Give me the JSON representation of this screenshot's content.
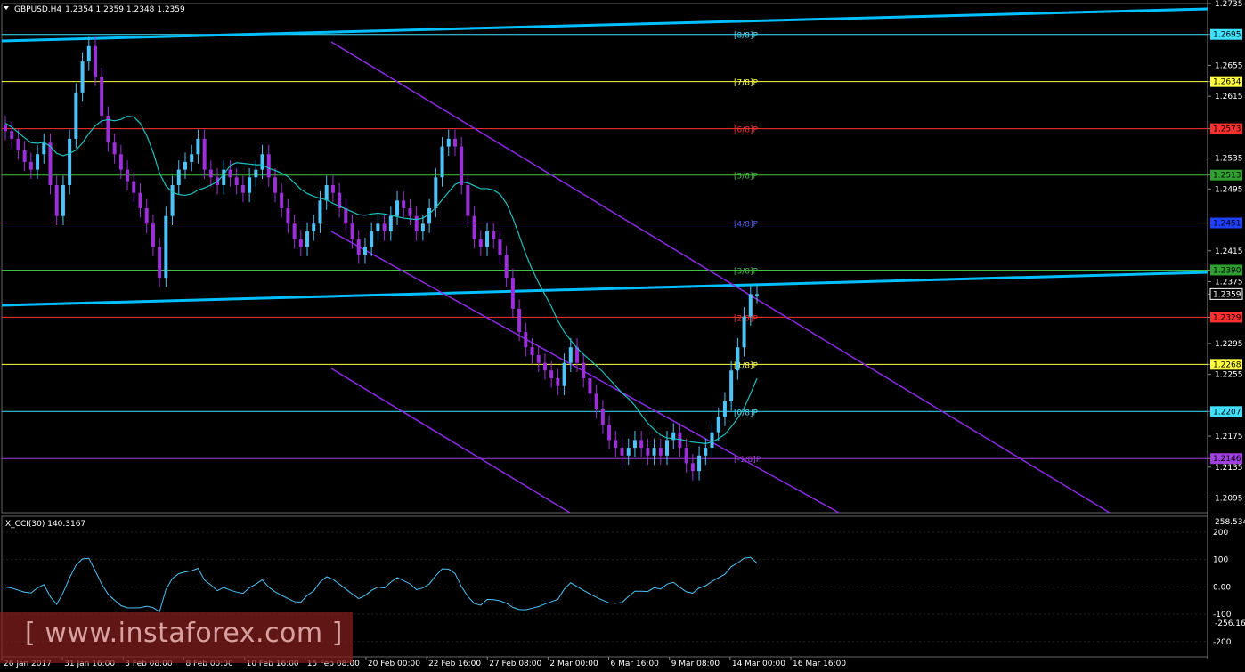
{
  "header": {
    "symbol": "GBPUSD,H4",
    "ohlc": "1.2354 1.2359 1.2348 1.2359"
  },
  "indicator": {
    "label": "X_CCI(30) 140.3167",
    "scale_top": "258.534",
    "scale_bottom": "-256.162",
    "ticks": [
      "200",
      "100",
      "0.00",
      "-100",
      "-200"
    ]
  },
  "watermark": "[ www.instaforex.com ]",
  "colors": {
    "background": "#000000",
    "bull_candle": "#4fc3f7",
    "bear_candle": "#9b30d9",
    "ma_line": "#20c0c0",
    "channel": "#00bfff",
    "trend": "#8a2be2",
    "grid": "#333333"
  },
  "chart_data": {
    "type": "candlestick",
    "symbol": "GBPUSD",
    "timeframe": "H4",
    "price_axis": {
      "range": [
        1.2076,
        1.2735
      ],
      "tick_labels": [
        "1.2735",
        "1.2695",
        "1.2655",
        "1.2634",
        "1.2615",
        "1.2573",
        "1.2535",
        "1.2513",
        "1.2495",
        "1.2451",
        "1.2415",
        "1.2390",
        "1.2375",
        "1.2359",
        "1.2329",
        "1.2295",
        "1.2268",
        "1.2255",
        "1.2207",
        "1.2175",
        "1.2146",
        "1.2135",
        "1.2095"
      ]
    },
    "time_axis": {
      "labels": [
        "26 Jan 2017",
        "31 Jan 16:00",
        "3 Feb 08:00",
        "8 Feb 00:00",
        "10 Feb 16:00",
        "15 Feb 08:00",
        "20 Feb 00:00",
        "22 Feb 16:00",
        "27 Feb 08:00",
        "2 Mar 00:00",
        "6 Mar 16:00",
        "9 Mar 08:00",
        "14 Mar 00:00",
        "16 Mar 16:00"
      ]
    },
    "current_price": 1.2359,
    "murrey_levels": [
      {
        "label": "[8/8]P",
        "price": 1.2695,
        "color": "#40e0ff"
      },
      {
        "label": "[7/8]P",
        "price": 1.2634,
        "color": "#ffff40"
      },
      {
        "label": "[6/8]P",
        "price": 1.2573,
        "color": "#ff3030"
      },
      {
        "label": "[5/8]P",
        "price": 1.2513,
        "color": "#40c040"
      },
      {
        "label": "[4/8]P",
        "price": 1.2451,
        "color": "#4060ff"
      },
      {
        "label": "[3/8]P",
        "price": 1.239,
        "color": "#40c040"
      },
      {
        "label": "[2/8]P",
        "price": 1.2329,
        "color": "#ff3030"
      },
      {
        "label": "[1/8]P",
        "price": 1.2268,
        "color": "#ffff40"
      },
      {
        "label": "[0/8]P",
        "price": 1.2207,
        "color": "#40e0ff"
      },
      {
        "label": "[-1/8]P",
        "price": 1.2146,
        "color": "#a040e0"
      }
    ],
    "price_tags": [
      {
        "text": "1.2695",
        "price": 1.2695,
        "bg": "#40e0ff",
        "fg": "#000000"
      },
      {
        "text": "1.2634",
        "price": 1.2634,
        "bg": "#ffff40",
        "fg": "#000000"
      },
      {
        "text": "1.2573",
        "price": 1.2573,
        "bg": "#ff3030",
        "fg": "#000000"
      },
      {
        "text": "1.2513",
        "price": 1.2513,
        "bg": "#30a030",
        "fg": "#000000"
      },
      {
        "text": "1.2451",
        "price": 1.2451,
        "bg": "#2040ff",
        "fg": "#000000"
      },
      {
        "text": "1.2390",
        "price": 1.239,
        "bg": "#30a030",
        "fg": "#000000"
      },
      {
        "text": "1.2359",
        "price": 1.2359,
        "bg": "#000000",
        "fg": "#ffffff"
      },
      {
        "text": "1.2329",
        "price": 1.2329,
        "bg": "#ff3030",
        "fg": "#000000"
      },
      {
        "text": "1.2268",
        "price": 1.2268,
        "bg": "#ffff40",
        "fg": "#000000"
      },
      {
        "text": "1.2207",
        "price": 1.2207,
        "bg": "#40e0ff",
        "fg": "#000000"
      },
      {
        "text": "1.2146",
        "price": 1.2146,
        "bg": "#a040e0",
        "fg": "#000000"
      }
    ],
    "close_path": [
      1.257,
      1.256,
      1.2545,
      1.253,
      1.252,
      1.254,
      1.2555,
      1.25,
      1.246,
      1.25,
      1.256,
      1.262,
      1.266,
      1.268,
      1.264,
      1.259,
      1.2555,
      1.254,
      1.252,
      1.2505,
      1.249,
      1.247,
      1.245,
      1.242,
      1.238,
      1.246,
      1.25,
      1.252,
      1.253,
      1.254,
      1.256,
      1.252,
      1.251,
      1.25,
      1.252,
      1.251,
      1.25,
      1.249,
      1.251,
      1.252,
      1.254,
      1.251,
      1.249,
      1.247,
      1.245,
      1.243,
      1.242,
      1.244,
      1.245,
      1.248,
      1.25,
      1.249,
      1.247,
      1.245,
      1.243,
      1.241,
      1.242,
      1.244,
      1.245,
      1.244,
      1.246,
      1.248,
      1.247,
      1.246,
      1.244,
      1.245,
      1.247,
      1.251,
      1.255,
      1.256,
      1.255,
      1.25,
      1.246,
      1.243,
      1.242,
      1.244,
      1.243,
      1.241,
      1.238,
      1.234,
      1.231,
      1.229,
      1.228,
      1.227,
      1.226,
      1.225,
      1.224,
      1.227,
      1.229,
      1.227,
      1.225,
      1.223,
      1.221,
      1.219,
      1.217,
      1.216,
      1.215,
      1.216,
      1.217,
      1.216,
      1.215,
      1.216,
      1.215,
      1.217,
      1.218,
      1.216,
      1.214,
      1.213,
      1.215,
      1.216,
      1.218,
      1.22,
      1.222,
      1.226,
      1.229,
      1.233,
      1.2359,
      1.2359
    ]
  }
}
